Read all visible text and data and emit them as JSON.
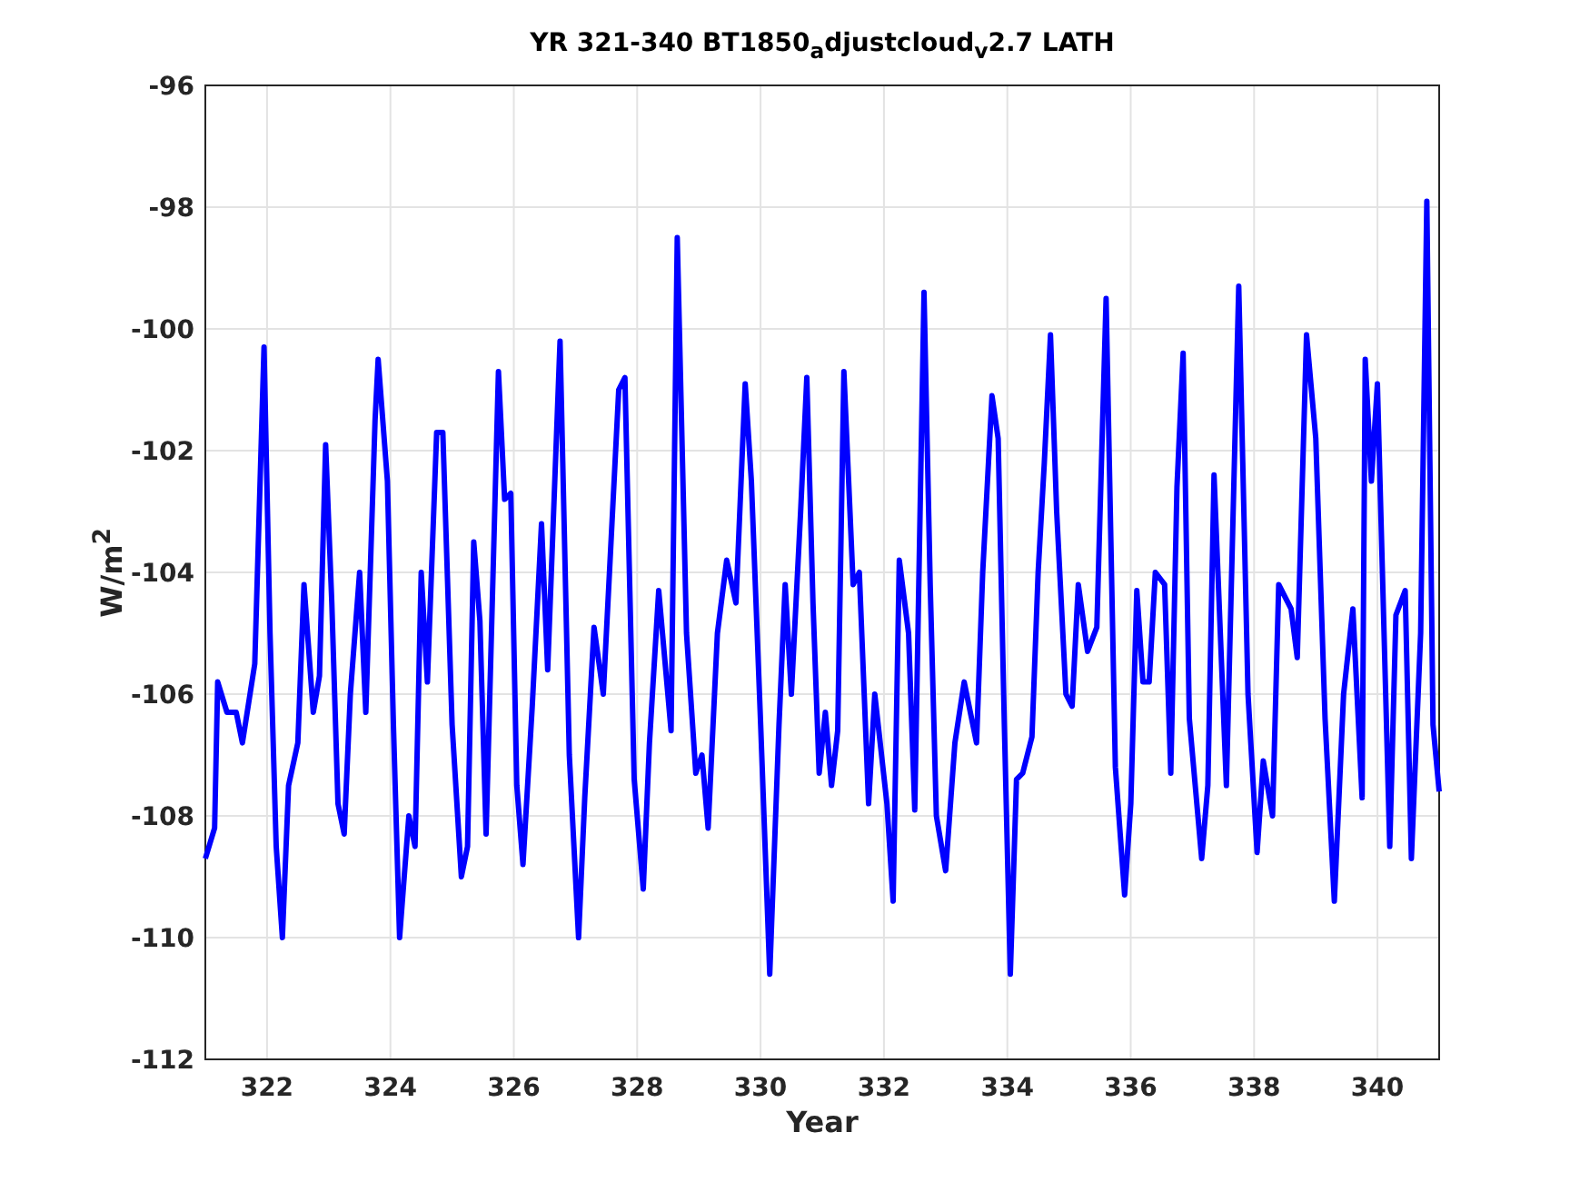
{
  "figure": {
    "chart_data": {
      "type": "line",
      "grid": true,
      "title": "YR 321-340 BT1850$_{a}$djustcloud$_{v}$2.7 LATH",
      "xlabel": "Year",
      "ylabel": "W/m$^{2}$",
      "xlim": [
        321,
        341
      ],
      "ylim": [
        -112,
        -96
      ],
      "xticks": [
        322,
        324,
        326,
        328,
        330,
        332,
        334,
        336,
        338,
        340
      ],
      "yticks": [
        -112,
        -110,
        -108,
        -106,
        -104,
        -102,
        -100,
        -98,
        -96
      ],
      "x": [
        321.0,
        321.15,
        321.2,
        321.35,
        321.5,
        321.6,
        321.8,
        321.95,
        322.05,
        322.15,
        322.25,
        322.35,
        322.5,
        322.6,
        322.75,
        322.85,
        322.95,
        323.05,
        323.15,
        323.25,
        323.35,
        323.5,
        323.6,
        323.75,
        323.8,
        323.95,
        324.05,
        324.15,
        324.3,
        324.4,
        324.5,
        324.6,
        324.75,
        324.85,
        325.0,
        325.15,
        325.25,
        325.35,
        325.45,
        325.55,
        325.75,
        325.85,
        325.95,
        326.05,
        326.15,
        326.3,
        326.45,
        326.55,
        326.75,
        326.9,
        327.05,
        327.15,
        327.3,
        327.45,
        327.55,
        327.7,
        327.8,
        327.95,
        328.1,
        328.2,
        328.35,
        328.55,
        328.65,
        328.8,
        328.95,
        329.05,
        329.15,
        329.3,
        329.45,
        329.6,
        329.75,
        329.85,
        330.0,
        330.15,
        330.3,
        330.4,
        330.5,
        330.65,
        330.75,
        330.85,
        330.95,
        331.05,
        331.15,
        331.25,
        331.35,
        331.5,
        331.6,
        331.75,
        331.85,
        332.05,
        332.15,
        332.25,
        332.4,
        332.5,
        332.65,
        332.75,
        332.85,
        333.0,
        333.15,
        333.3,
        333.5,
        333.6,
        333.75,
        333.85,
        333.95,
        334.05,
        334.15,
        334.25,
        334.4,
        334.5,
        334.6,
        334.7,
        334.8,
        334.95,
        335.05,
        335.15,
        335.3,
        335.45,
        335.6,
        335.75,
        335.9,
        336.0,
        336.1,
        336.2,
        336.3,
        336.4,
        336.55,
        336.65,
        336.75,
        336.85,
        336.95,
        337.15,
        337.25,
        337.35,
        337.55,
        337.75,
        337.9,
        338.05,
        338.15,
        338.3,
        338.4,
        338.6,
        338.7,
        338.85,
        339.0,
        339.15,
        339.3,
        339.45,
        339.6,
        339.75,
        339.8,
        339.9,
        340.0,
        340.2,
        340.3,
        340.45,
        340.55,
        340.7,
        340.8,
        340.9,
        341.0
      ],
      "series": [
        {
          "color": "#0000ff",
          "values": [
            -108.7,
            -108.2,
            -105.8,
            -106.3,
            -106.3,
            -106.8,
            -105.5,
            -100.3,
            -105,
            -108.5,
            -110,
            -107.5,
            -106.8,
            -104.2,
            -106.3,
            -105.7,
            -101.9,
            -104.5,
            -107.8,
            -108.3,
            -106,
            -104,
            -106.3,
            -101.5,
            -100.5,
            -102.5,
            -106.5,
            -110,
            -108,
            -108.5,
            -104,
            -105.8,
            -101.7,
            -101.7,
            -106.5,
            -109,
            -108.5,
            -103.5,
            -104.8,
            -108.3,
            -100.7,
            -102.8,
            -102.7,
            -107.5,
            -108.8,
            -106.2,
            -103.2,
            -105.6,
            -100.2,
            -107,
            -110,
            -107.7,
            -104.9,
            -106,
            -104,
            -101,
            -100.8,
            -107.4,
            -109.2,
            -106.8,
            -104.3,
            -106.6,
            -98.5,
            -105,
            -107.3,
            -107,
            -108.2,
            -105,
            -103.8,
            -104.5,
            -100.9,
            -102.5,
            -106.5,
            -110.6,
            -106.5,
            -104.2,
            -106,
            -103,
            -100.8,
            -104.5,
            -107.3,
            -106.3,
            -107.5,
            -106.6,
            -100.7,
            -104.2,
            -104,
            -107.8,
            -106,
            -107.8,
            -109.4,
            -103.8,
            -105,
            -107.9,
            -99.4,
            -104.2,
            -108,
            -108.9,
            -106.8,
            -105.8,
            -106.8,
            -104,
            -101.1,
            -101.8,
            -106.5,
            -110.6,
            -107.4,
            -107.3,
            -106.7,
            -104,
            -102.2,
            -100.1,
            -103,
            -106,
            -106.2,
            -104.2,
            -105.3,
            -104.9,
            -99.5,
            -107.2,
            -109.3,
            -107.8,
            -104.3,
            -105.8,
            -105.8,
            -104,
            -104.2,
            -107.3,
            -102.6,
            -100.4,
            -106.4,
            -108.7,
            -107.5,
            -102.4,
            -107.5,
            -99.3,
            -106,
            -108.6,
            -107.1,
            -108,
            -104.2,
            -104.6,
            -105.4,
            -100.1,
            -101.8,
            -106.4,
            -109.4,
            -106,
            -104.6,
            -107.7,
            -100.5,
            -102.5,
            -100.9,
            -108.5,
            -104.7,
            -104.3,
            -108.7,
            -105,
            -97.9,
            -106.5,
            -107.6
          ]
        }
      ]
    }
  }
}
